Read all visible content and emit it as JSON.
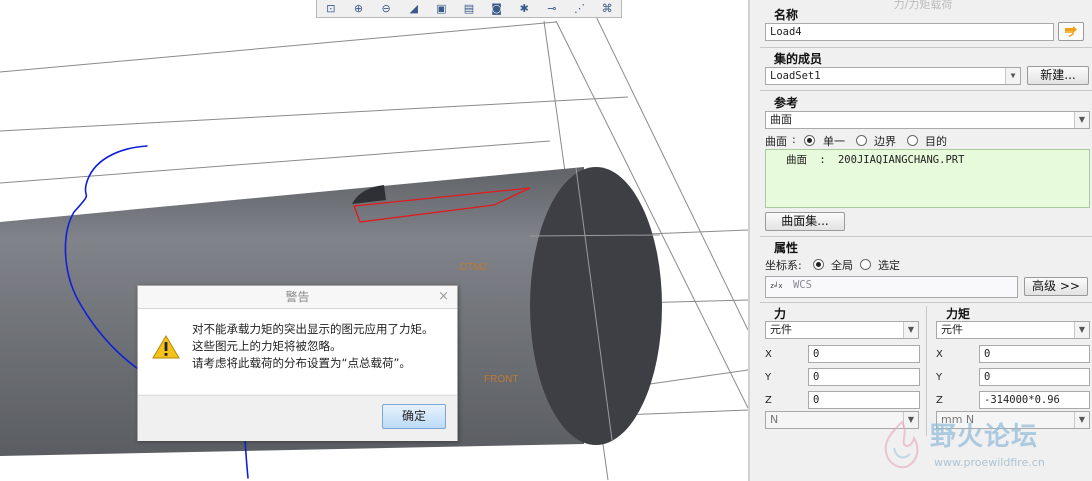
{
  "viewport": {
    "datum_labels": [
      "DTM2",
      "FRONT"
    ]
  },
  "toolbar": {
    "icons": [
      "zoom-fit-icon",
      "zoom-in-icon",
      "zoom-out-icon",
      "repaint-icon",
      "view-orient-icon",
      "saved-views-icon",
      "display-style-icon",
      "datum-display-icon",
      "spin-center-icon",
      "axis-display-icon",
      "csys-display-icon"
    ]
  },
  "warning_dialog": {
    "title": "警告",
    "close": "×",
    "lines": [
      "对不能承载力矩的突出显示的图元应用了力矩。",
      "这些图元上的力矩将被忽略。",
      "请考虑将此载荷的分布设置为“点总载荷”。"
    ],
    "ok_label": "确定"
  },
  "panel": {
    "title": "力/力矩载荷",
    "name": {
      "label": "名称",
      "value": "Load4"
    },
    "set": {
      "label": "集的成员",
      "value": "LoadSet1",
      "new_label": "新建..."
    },
    "refs": {
      "label": "参考",
      "type": "曲面",
      "surface_label": "曲面",
      "colon": ":",
      "options": [
        "单一",
        "边界",
        "目的"
      ],
      "selected": "单一",
      "item_label": "曲面",
      "item_value": "200JIAQIANGCHANG.PRT",
      "surfset_label": "曲面集..."
    },
    "props": {
      "label": "属性",
      "csys_label": "坐标系:",
      "options": [
        "全局",
        "选定"
      ],
      "selected": "全局",
      "csys_value": "WCS",
      "advanced_label": "高级 >>"
    },
    "force": {
      "label": "力",
      "mode": "元件",
      "x_label": "X",
      "x": "0",
      "y_label": "Y",
      "y": "0",
      "z_label": "Z",
      "z": "0",
      "unit": "N"
    },
    "moment": {
      "label": "力矩",
      "mode": "元件",
      "x_label": "X",
      "x": "0",
      "y_label": "Y",
      "y": "0",
      "z_label": "Z",
      "z": "-314000*0.96",
      "unit": "mm N"
    }
  },
  "watermark": {
    "text": "野火论坛",
    "url": "www.proewildfire.cn"
  },
  "colors": {
    "cylinder": "#727579",
    "end_face": "#3d3f45",
    "highlight": "#e11b1b",
    "annotation": "#1020d8",
    "datum": "#c07a32"
  }
}
